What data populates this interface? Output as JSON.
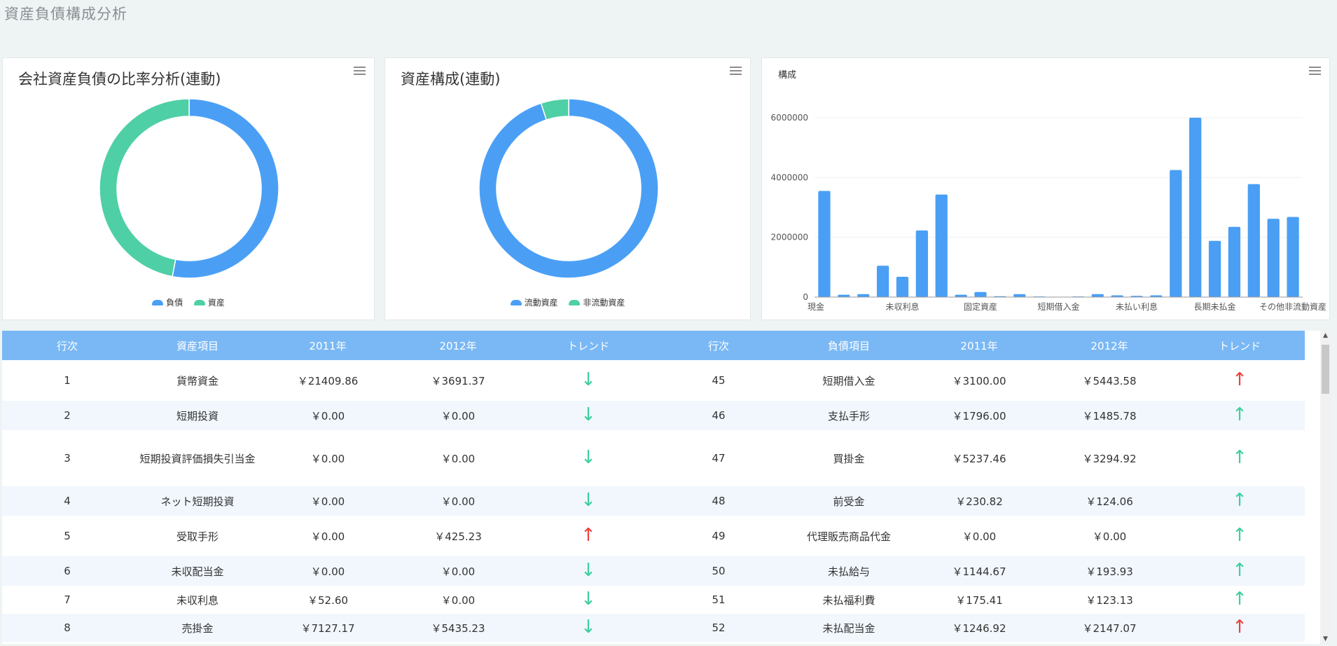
{
  "page": {
    "title": "資産負債構成分析"
  },
  "panel1": {
    "title": "会社資産負債の比率分析(連動)",
    "chart_data": {
      "type": "pie",
      "categories": [
        "負債",
        "資産"
      ],
      "values": [
        53,
        47
      ],
      "colors": [
        "#4a9ff5",
        "#4fcfa6"
      ]
    },
    "legend": [
      "負債",
      "資産"
    ]
  },
  "panel2": {
    "title": "資産構成(連動)",
    "chart_data": {
      "type": "pie",
      "categories": [
        "流動資産",
        "非流動資産"
      ],
      "values": [
        95,
        5
      ],
      "colors": [
        "#4a9ff5",
        "#4fcfa6"
      ]
    },
    "legend": [
      "流動資産",
      "非流動資産"
    ]
  },
  "panel3": {
    "title": "構成",
    "chart_data": {
      "type": "bar",
      "xlabels_shown": [
        "現金",
        "未収利息",
        "固定資産",
        "短期借入金",
        "未払い利息",
        "長期未払金",
        "その他非流動資産"
      ],
      "values": [
        3550000,
        80000,
        100000,
        1050000,
        680000,
        2230000,
        3430000,
        80000,
        170000,
        30000,
        100000,
        20000,
        10000,
        20000,
        100000,
        60000,
        40000,
        60000,
        4250000,
        6000000,
        1880000,
        2350000,
        3780000,
        2620000,
        2680000
      ],
      "yticks": [
        "0",
        "2000000",
        "4000000",
        "6000000"
      ],
      "ylim": [
        0,
        6000000
      ],
      "color": "#4a9ff5"
    }
  },
  "table": {
    "headers": [
      "行次",
      "資産項目",
      "2011年",
      "2012年",
      "トレンド",
      "行次",
      "負債項目",
      "2011年",
      "2012年",
      "トレンド"
    ],
    "rows": [
      [
        "1",
        "貨幣資金",
        "￥21409.86",
        "￥3691.37",
        "down",
        "45",
        "短期借入金",
        "￥3100.00",
        "￥5443.58",
        "up-red"
      ],
      [
        "2",
        "短期投資",
        "￥0.00",
        "￥0.00",
        "down",
        "46",
        "支払手形",
        "￥1796.00",
        "￥1485.78",
        "up"
      ],
      [
        "3",
        "短期投資評価損失引当金",
        "￥0.00",
        "￥0.00",
        "down",
        "47",
        "買掛金",
        "￥5237.46",
        "￥3294.92",
        "up"
      ],
      [
        "4",
        "ネット短期投資",
        "￥0.00",
        "￥0.00",
        "down",
        "48",
        "前受金",
        "￥230.82",
        "￥124.06",
        "up"
      ],
      [
        "5",
        "受取手形",
        "￥0.00",
        "￥425.23",
        "up-red",
        "49",
        "代理販売商品代金",
        "￥0.00",
        "￥0.00",
        "up"
      ],
      [
        "6",
        "未収配当金",
        "￥0.00",
        "￥0.00",
        "down",
        "50",
        "未払給与",
        "￥1144.67",
        "￥193.93",
        "up"
      ],
      [
        "7",
        "未収利息",
        "￥52.60",
        "￥0.00",
        "down",
        "51",
        "未払福利費",
        "￥175.41",
        "￥123.13",
        "up"
      ],
      [
        "8",
        "売掛金",
        "￥7127.17",
        "￥5435.23",
        "down",
        "52",
        "未払配当金",
        "￥1246.92",
        "￥2147.07",
        "up-red"
      ]
    ]
  }
}
